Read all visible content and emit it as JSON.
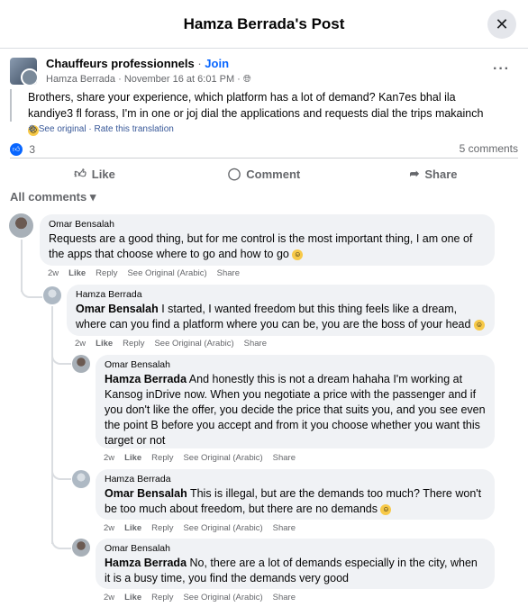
{
  "header": {
    "title": "Hamza Berrada's Post",
    "close_icon": "close-icon"
  },
  "post": {
    "group_name": "Chauffeurs professionnels",
    "separator": "·",
    "join_label": "Join",
    "author": "Hamza Berrada",
    "date": "November 16 at 6:01 PM",
    "privacy_icon": "globe-icon",
    "text": "Brothers, share your experience, which platform has a lot of demand? Kan7es bhal ila kandiye3 fl forass, I'm in one or joj dial the applications and requests dial the trips makainch",
    "see_original": "See original",
    "rate_translation": "Rate this translation",
    "translation_sep": "·",
    "reaction_count": "3",
    "comments_count": "5 comments",
    "actions": {
      "like": "Like",
      "comment": "Comment",
      "share": "Share"
    }
  },
  "sort_label": "All comments",
  "comments": [
    {
      "author": "Omar Bensalah",
      "tag": "",
      "text": "Requests are a good thing, but for me control is the most important thing, I am one of the apps that choose where to go and how to go",
      "emoji": "😄",
      "time": "2w",
      "like": "Like",
      "reply": "Reply",
      "see_original": "See Original (Arabic)",
      "share": "Share"
    },
    {
      "author": "Hamza Berrada",
      "tag": "Omar Bensalah",
      "text": " I started, I wanted freedom but this thing feels like a dream, where can you find a platform where you can be, you are the boss of your head",
      "emoji": "😂",
      "time": "2w",
      "like": "Like",
      "reply": "Reply",
      "see_original": "See Original (Arabic)",
      "share": "Share"
    },
    {
      "author": "Omar Bensalah",
      "tag": "Hamza Berrada",
      "text": " And honestly this is not a dream hahaha I'm working at Kansog inDrive now. When you negotiate a price with the passenger and if you don't like the offer, you decide the price that suits you, and you see even the point B before you accept and from it you choose whether you want this target or not",
      "emoji": "",
      "time": "2w",
      "like": "Like",
      "reply": "Reply",
      "see_original": "See Original (Arabic)",
      "share": "Share"
    },
    {
      "author": "Hamza Berrada",
      "tag": "Omar Bensalah",
      "text": " This is illegal, but are the demands too much? There won't be too much about freedom, but there are no demands",
      "emoji": "😂",
      "time": "2w",
      "like": "Like",
      "reply": "Reply",
      "see_original": "See Original (Arabic)",
      "share": "Share"
    },
    {
      "author": "Omar Bensalah",
      "tag": "Hamza Berrada",
      "text": " No, there are a lot of demands especially in the city, when it is a busy time, you find the demands very good",
      "emoji": "",
      "time": "2w",
      "like": "Like",
      "reply": "Reply",
      "see_original": "See Original (Arabic)",
      "share": "Share"
    }
  ]
}
